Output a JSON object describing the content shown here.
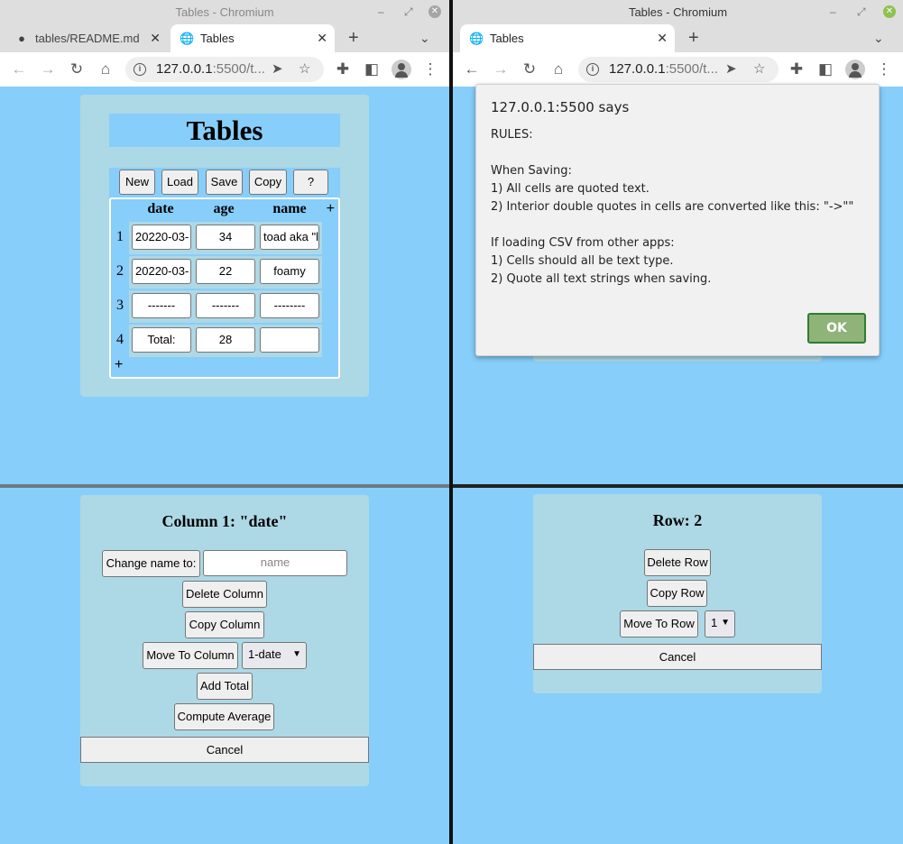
{
  "left_browser": {
    "window_title": "Tables - Chromium",
    "tabs": [
      {
        "label": "tables/README.md"
      },
      {
        "label": "Tables"
      }
    ],
    "url_host": "127.0.0.1",
    "url_rest": ":5500/t..."
  },
  "right_browser": {
    "window_title": "Tables - Chromium",
    "tabs": [
      {
        "label": "Tables"
      }
    ],
    "url_host": "127.0.0.1",
    "url_rest": ":5500/t..."
  },
  "app": {
    "title": "Tables",
    "buttons": {
      "new": "New",
      "load": "Load",
      "save": "Save",
      "copy": "Copy",
      "help": "?"
    },
    "columns": [
      "date",
      "age",
      "name"
    ],
    "add_col": "+",
    "add_row": "+",
    "rows": [
      {
        "num": "1",
        "cells": [
          "20220-03-",
          "34",
          "toad aka \"l"
        ]
      },
      {
        "num": "2",
        "cells": [
          "20220-03-",
          "22",
          "foamy"
        ]
      },
      {
        "num": "3",
        "cells": [
          "-------",
          "-------",
          "--------"
        ]
      },
      {
        "num": "4",
        "cells": [
          "Total:",
          "28",
          ""
        ]
      }
    ]
  },
  "dialog": {
    "title": "127.0.0.1:5500 says",
    "lines": [
      "RULES:",
      "When Saving:",
      "1) All cells are quoted text.",
      "2) Interior double quotes in cells are converted like this: \"->\"\"",
      "If loading CSV from other apps:",
      "1) Cells should all be text type.",
      "2) Quote all text strings when saving."
    ],
    "ok": "OK"
  },
  "column_panel": {
    "title": "Column 1: \"date\"",
    "change_name": "Change name to:",
    "name_placeholder": "name",
    "delete": "Delete Column",
    "copy": "Copy Column",
    "move": "Move To Column",
    "move_value": "1-date",
    "add_total": "Add Total",
    "compute_average": "Compute Average",
    "cancel": "Cancel"
  },
  "row_panel": {
    "title": "Row: 2",
    "delete": "Delete Row",
    "copy": "Copy Row",
    "move": "Move To Row",
    "move_value": "1",
    "cancel": "Cancel"
  }
}
